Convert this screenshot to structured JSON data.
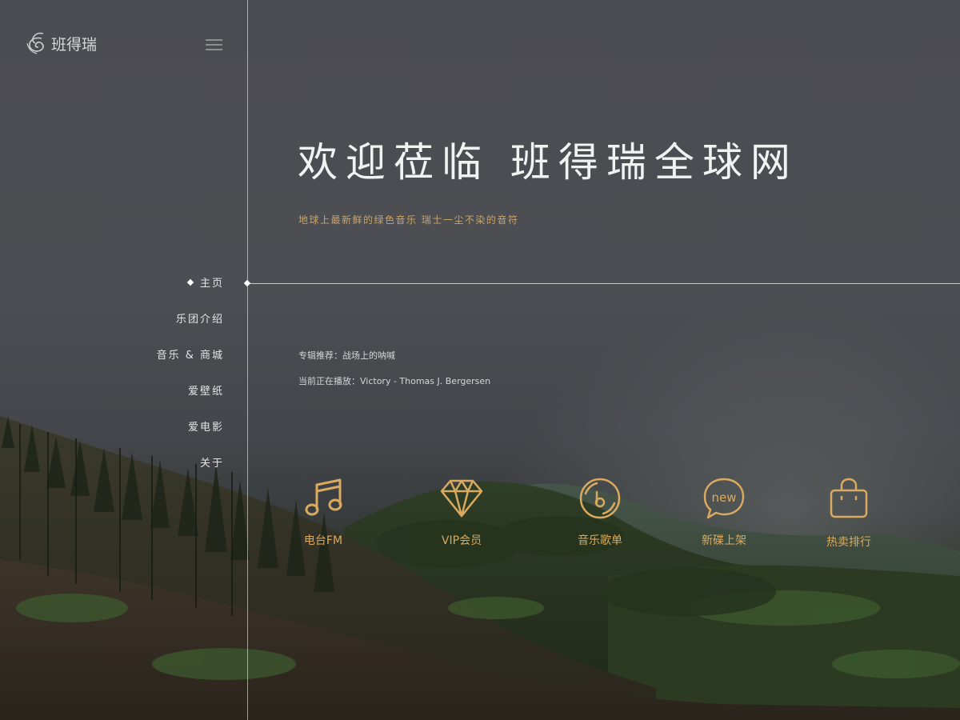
{
  "brand": {
    "logo_text": "班得瑞",
    "accent_color": "#d9aa5f"
  },
  "header": {
    "menu_icon": "hamburger-menu-icon"
  },
  "nav": {
    "items": [
      {
        "label": "主页",
        "active": true
      },
      {
        "label": "乐团介绍",
        "active": false
      },
      {
        "label": "音乐 & 商城",
        "active": false
      },
      {
        "label": "爱壁纸",
        "active": false
      },
      {
        "label": "爱电影",
        "active": false
      },
      {
        "label": "关于",
        "active": false
      }
    ]
  },
  "hero": {
    "title": "欢迎莅临 班得瑞全球网",
    "subtitle": "地球上最新鲜的绿色音乐 瑞士一尘不染的音符"
  },
  "info": {
    "album_line": "专辑推荐：战场上的呐喊",
    "now_playing_line": "当前正在播放：Victory - Thomas J. Bergersen"
  },
  "features": [
    {
      "label": "电台FM",
      "icon": "music-note-icon"
    },
    {
      "label": "VIP会员",
      "icon": "diamond-icon"
    },
    {
      "label": "音乐歌单",
      "icon": "music-disc-icon"
    },
    {
      "label": "新碟上架",
      "icon": "new-bubble-icon",
      "icon_text": "new"
    },
    {
      "label": "热卖排行",
      "icon": "shopping-bag-icon"
    }
  ]
}
